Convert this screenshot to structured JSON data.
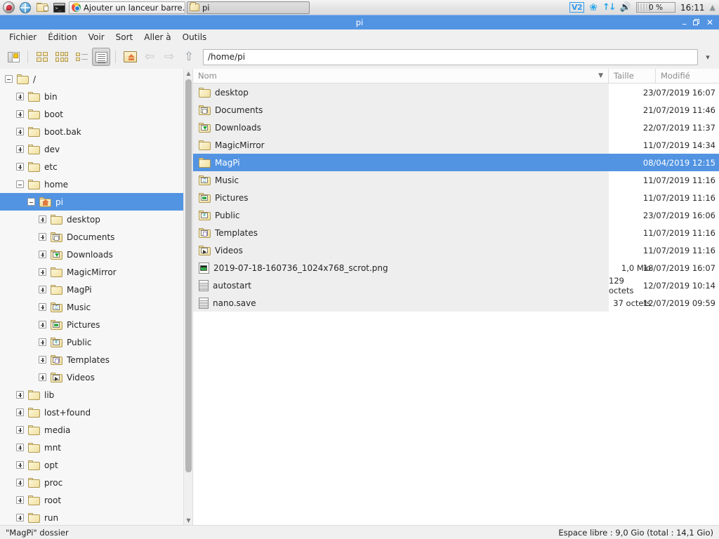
{
  "taskbar": {
    "launchers": [
      {
        "name": "raspberry-menu",
        "icon": "raspberry-icon"
      },
      {
        "name": "web-browser",
        "icon": "globe-icon"
      },
      {
        "name": "file-manager",
        "icon": "folder-icon"
      },
      {
        "name": "terminal",
        "icon": "terminal-icon"
      }
    ],
    "windows": [
      {
        "label": "Ajouter un lanceur barre…",
        "icon": "chromium-icon",
        "active": false
      },
      {
        "label": "pi",
        "icon": "folder-icon",
        "active": true
      }
    ],
    "tray": {
      "vnc_label": "V2",
      "bluetooth_icon": "bluetooth-icon",
      "network_icon": "network-updown-icon",
      "volume_icon": "speaker-icon",
      "cpu_label": "0 %",
      "clock": "16:11",
      "eject_icon": "eject-icon"
    }
  },
  "window": {
    "title": "pi",
    "controls": {
      "minimize": "–",
      "restore": "❐",
      "close": "✕"
    }
  },
  "menubar": {
    "items": [
      "Fichier",
      "Édition",
      "Voir",
      "Sort",
      "Aller à",
      "Outils"
    ]
  },
  "toolbar": {
    "buttons": [
      {
        "name": "toggle-sidebar",
        "icon": "sidebar-icon",
        "pressed": false
      },
      {
        "name": "view-icons",
        "icon": "grid-large-icon",
        "pressed": false
      },
      {
        "name": "view-compact",
        "icon": "grid-small-icon",
        "pressed": false
      },
      {
        "name": "view-thumbnails",
        "icon": "thumbnail-list-icon",
        "pressed": false
      },
      {
        "name": "view-detailed-list",
        "icon": "detail-list-icon",
        "pressed": true
      },
      {
        "name": "go-home",
        "icon": "home-icon",
        "pressed": false
      },
      {
        "name": "go-back",
        "icon": "arrow-left-icon",
        "pressed": false
      },
      {
        "name": "go-forward",
        "icon": "arrow-right-icon",
        "pressed": false
      },
      {
        "name": "go-up",
        "icon": "arrow-up-icon",
        "pressed": false
      }
    ],
    "path_value": "/home/pi",
    "path_dropdown_icon": "chevron-down-icon"
  },
  "tree": [
    {
      "label": "/",
      "depth": 0,
      "state": "expanded",
      "icon": "folder"
    },
    {
      "label": "bin",
      "depth": 1,
      "state": "collapsed",
      "icon": "folder"
    },
    {
      "label": "boot",
      "depth": 1,
      "state": "collapsed",
      "icon": "folder"
    },
    {
      "label": "boot.bak",
      "depth": 1,
      "state": "collapsed",
      "icon": "folder"
    },
    {
      "label": "dev",
      "depth": 1,
      "state": "collapsed",
      "icon": "folder"
    },
    {
      "label": "etc",
      "depth": 1,
      "state": "collapsed",
      "icon": "folder"
    },
    {
      "label": "home",
      "depth": 1,
      "state": "expanded",
      "icon": "folder"
    },
    {
      "label": "pi",
      "depth": 2,
      "state": "expanded",
      "icon": "home",
      "selected": true
    },
    {
      "label": "desktop",
      "depth": 3,
      "state": "collapsed",
      "icon": "folder"
    },
    {
      "label": "Documents",
      "depth": 3,
      "state": "collapsed",
      "icon": "documents"
    },
    {
      "label": "Downloads",
      "depth": 3,
      "state": "collapsed",
      "icon": "downloads"
    },
    {
      "label": "MagicMirror",
      "depth": 3,
      "state": "collapsed",
      "icon": "folder"
    },
    {
      "label": "MagPi",
      "depth": 3,
      "state": "collapsed",
      "icon": "folder"
    },
    {
      "label": "Music",
      "depth": 3,
      "state": "collapsed",
      "icon": "music"
    },
    {
      "label": "Pictures",
      "depth": 3,
      "state": "collapsed",
      "icon": "pictures"
    },
    {
      "label": "Public",
      "depth": 3,
      "state": "collapsed",
      "icon": "public"
    },
    {
      "label": "Templates",
      "depth": 3,
      "state": "collapsed",
      "icon": "templates"
    },
    {
      "label": "Videos",
      "depth": 3,
      "state": "collapsed",
      "icon": "videos"
    },
    {
      "label": "lib",
      "depth": 1,
      "state": "collapsed",
      "icon": "folder"
    },
    {
      "label": "lost+found",
      "depth": 1,
      "state": "collapsed",
      "icon": "folder"
    },
    {
      "label": "media",
      "depth": 1,
      "state": "collapsed",
      "icon": "folder"
    },
    {
      "label": "mnt",
      "depth": 1,
      "state": "collapsed",
      "icon": "folder"
    },
    {
      "label": "opt",
      "depth": 1,
      "state": "collapsed",
      "icon": "folder"
    },
    {
      "label": "proc",
      "depth": 1,
      "state": "collapsed",
      "icon": "folder"
    },
    {
      "label": "root",
      "depth": 1,
      "state": "collapsed",
      "icon": "folder"
    },
    {
      "label": "run",
      "depth": 1,
      "state": "collapsed",
      "icon": "folder"
    }
  ],
  "list": {
    "columns": {
      "name": "Nom",
      "size": "Taille",
      "modified": "Modifié"
    },
    "rows": [
      {
        "name": "desktop",
        "size": "",
        "modified": "23/07/2019 16:07",
        "icon": "folder",
        "selected": false
      },
      {
        "name": "Documents",
        "size": "",
        "modified": "21/07/2019 11:46",
        "icon": "documents",
        "selected": false
      },
      {
        "name": "Downloads",
        "size": "",
        "modified": "22/07/2019 11:37",
        "icon": "downloads",
        "selected": false
      },
      {
        "name": "MagicMirror",
        "size": "",
        "modified": "11/07/2019 14:34",
        "icon": "folder",
        "selected": false
      },
      {
        "name": "MagPi",
        "size": "",
        "modified": "08/04/2019 12:15",
        "icon": "folder",
        "selected": true
      },
      {
        "name": "Music",
        "size": "",
        "modified": "11/07/2019 11:16",
        "icon": "music",
        "selected": false
      },
      {
        "name": "Pictures",
        "size": "",
        "modified": "11/07/2019 11:16",
        "icon": "pictures",
        "selected": false
      },
      {
        "name": "Public",
        "size": "",
        "modified": "23/07/2019 16:06",
        "icon": "public",
        "selected": false
      },
      {
        "name": "Templates",
        "size": "",
        "modified": "11/07/2019 11:16",
        "icon": "templates",
        "selected": false
      },
      {
        "name": "Videos",
        "size": "",
        "modified": "11/07/2019 11:16",
        "icon": "videos",
        "selected": false
      },
      {
        "name": "2019-07-18-160736_1024x768_scrot.png",
        "size": "1,0 Mio",
        "modified": "18/07/2019 16:07",
        "icon": "image-file",
        "selected": false
      },
      {
        "name": "autostart",
        "size": "129 octets",
        "modified": "12/07/2019 10:14",
        "icon": "text-file",
        "selected": false
      },
      {
        "name": "nano.save",
        "size": "37 octets",
        "modified": "12/07/2019 09:59",
        "icon": "text-file",
        "selected": false
      }
    ]
  },
  "statusbar": {
    "left": "\"MagPi\" dossier",
    "right": "Espace libre : 9,0 Gio (total : 14,1 Gio)"
  },
  "colors": {
    "accent": "#5294e2",
    "window_bg": "#f0f0f0",
    "row_name_bg": "#eeeeee",
    "folder_yellow": "#f0dca2"
  }
}
